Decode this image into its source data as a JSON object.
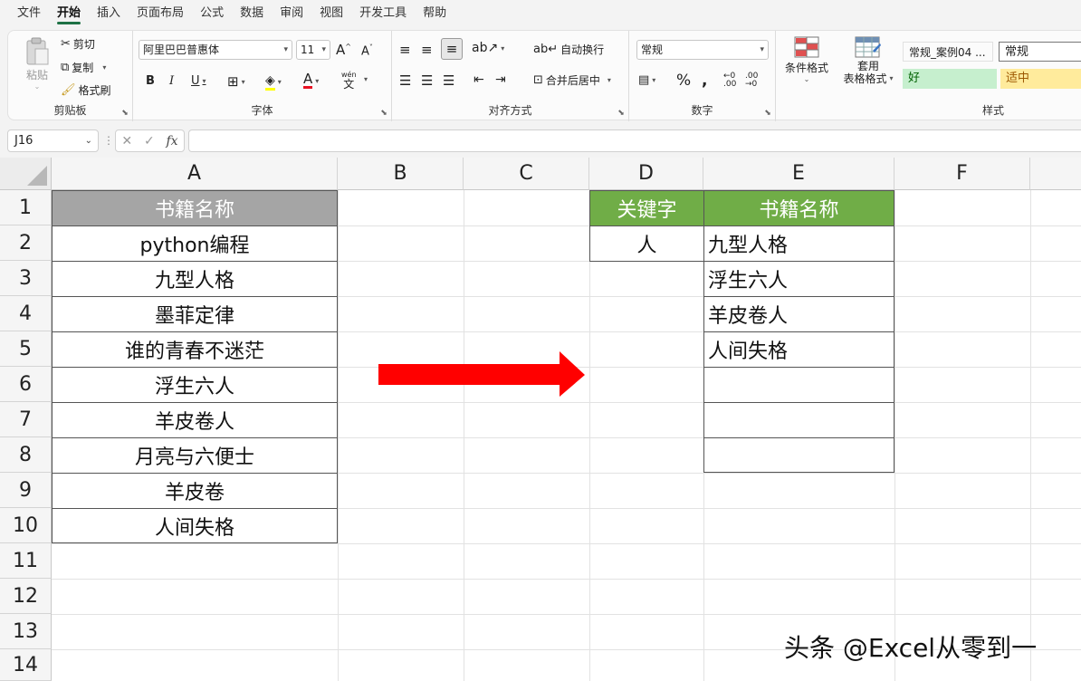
{
  "menu": {
    "tabs": [
      "文件",
      "开始",
      "插入",
      "页面布局",
      "公式",
      "数据",
      "审阅",
      "视图",
      "开发工具",
      "帮助"
    ],
    "active_index": 1
  },
  "ribbon": {
    "clipboard": {
      "label": "剪贴板",
      "paste": "粘贴",
      "cut": "剪切",
      "copy": "复制",
      "format_painter": "格式刷"
    },
    "font": {
      "label": "字体",
      "font_name": "阿里巴巴普惠体",
      "font_size": "11",
      "bold": "B",
      "italic": "I",
      "underline": "U",
      "wen": "wén",
      "font_color": "#e81123"
    },
    "alignment": {
      "label": "对齐方式",
      "wrap_text": "自动换行",
      "merge_center": "合并后居中"
    },
    "number": {
      "label": "数字",
      "format": "常规"
    },
    "styles": {
      "label": "样式",
      "conditional_format": "条件格式",
      "table_format_line1": "套用",
      "table_format_line2": "表格格式",
      "style_case": "常规_案例04 ...",
      "style_normal": "常规",
      "style_good": "好",
      "style_neutral": "适中",
      "good_bg": "#c6efce",
      "good_fg": "#006100",
      "neutral_bg": "#ffeb9c",
      "neutral_fg": "#9c5700"
    }
  },
  "formula_bar": {
    "name_box": "J16",
    "fx": "fx",
    "content": ""
  },
  "sheet": {
    "columns": [
      "A",
      "B",
      "C",
      "D",
      "E",
      "F"
    ],
    "rows": [
      "1",
      "2",
      "3",
      "4",
      "5",
      "6",
      "7",
      "8",
      "9",
      "10",
      "11",
      "12",
      "13",
      "14"
    ],
    "colA_header": "书籍名称",
    "colA_values": [
      "python编程",
      "九型人格",
      "墨菲定律",
      "谁的青春不迷茫",
      "浮生六人",
      "羊皮卷人",
      "月亮与六便士",
      "羊皮卷",
      "人间失格"
    ],
    "keyword_header": "关键字",
    "keyword_value": "人",
    "result_header": "书籍名称",
    "result_values": [
      "九型人格",
      "浮生六人",
      "羊皮卷人",
      "人间失格",
      "",
      "",
      ""
    ],
    "header_gray": "#a5a5a5",
    "header_green": "#70ad47",
    "arrow_color": "#ff0000"
  },
  "watermark": "头条 @Excel从零到一"
}
